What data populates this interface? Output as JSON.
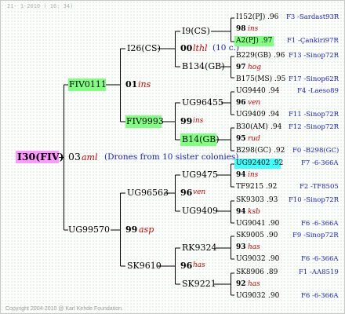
{
  "header": {
    "date_text": "21-  1-2010 ( 16: 34)"
  },
  "footer": {
    "copyright": "Copyright 2004-2010 @ Karl Kehde Foundation."
  },
  "colors": {
    "root_bg": "#ff99ff",
    "green_bg": "#80ff80",
    "cyan_bg": "#40ffff",
    "mating_text": "#cc0000",
    "link_text": "#1a1acc",
    "line": "#000000"
  },
  "root": {
    "name": "I30(FIV)",
    "year": "03",
    "mating": "aml",
    "note": "(Drones from 10 sister colonies)"
  },
  "gen1": {
    "top": "FIV0111",
    "bottom": "UG99570"
  },
  "gen2": [
    {
      "name": "I26(CS)",
      "year": "01",
      "mating": "ins"
    },
    {
      "name": "FIV9993"
    },
    {
      "name": "UG96563",
      "year": "99",
      "mating": "asp"
    },
    {
      "name": "SK9610"
    }
  ],
  "gen3": [
    {
      "name": "I9(CS)",
      "year": "00",
      "mating": "lthl",
      "note": "(10 c.)"
    },
    {
      "name": "B134(GB)"
    },
    {
      "name": "UG96455",
      "year": "99",
      "mating": "ins"
    },
    {
      "name": "B14(GB)"
    },
    {
      "name": "UG9475",
      "year": "96",
      "mating": "ven"
    },
    {
      "name": "UG9409"
    },
    {
      "name": "RK9324",
      "year": "96",
      "mating": "has"
    },
    {
      "name": "SK9221"
    }
  ],
  "gen4": [
    {
      "top": {
        "name": "I152(PJ)",
        "year": ".96",
        "info": "F3 -Sardast93R"
      },
      "mid": {
        "year": "98",
        "mating": "ins"
      },
      "bot": {
        "name": "A2(PJ)",
        "year": ".97",
        "info": "F1 -Çankiri97R"
      }
    },
    {
      "top": {
        "name": "B229(GB)",
        "year": ".96",
        "info": "F13 -Sinop72R"
      },
      "mid": {
        "year": "97",
        "mating": "hog"
      },
      "bot": {
        "name": "B175(MS)",
        "year": ".95",
        "info": "F17 -Sinop62R"
      }
    },
    {
      "top": {
        "name": "UG9440",
        "year": ".94",
        "info": "F4 -Laeso89"
      },
      "mid": {
        "year": "96",
        "mating": "ven"
      },
      "bot": {
        "name": "UG9409",
        "year": ".94",
        "info": "F11 -Sinop72R"
      }
    },
    {
      "top": {
        "name": "B30(AM)",
        "year": ".94",
        "info": "F12 -Sinop72R"
      },
      "mid": {
        "year": "95",
        "mating": "rud"
      },
      "bot": {
        "name": "B298(GC)",
        "year": ".92",
        "info": "F0 -B298(GC)"
      }
    },
    {
      "top": {
        "name": "UG92402",
        "year": ".92",
        "info": "F7 -6-366A"
      },
      "mid": {
        "year": "94",
        "mating": "ins"
      },
      "bot": {
        "name": "TF9215",
        "year": ".92",
        "info": "F2 -TF8505"
      }
    },
    {
      "top": {
        "name": "SK9303",
        "year": ".93",
        "info": "F10 -Sinop72R"
      },
      "mid": {
        "year": "94",
        "mating": "ksb"
      },
      "bot": {
        "name": "UG9041",
        "year": ".90",
        "info": "F6 -6-366A"
      }
    },
    {
      "top": {
        "name": "SK9005",
        "year": ".90",
        "info": "F9 -Sinop72R"
      },
      "mid": {
        "year": "93",
        "mating": "has"
      },
      "bot": {
        "name": "UG9032",
        "year": ".90",
        "info": "F6 -6-366A"
      }
    },
    {
      "top": {
        "name": "SK8906",
        "year": ".89",
        "info": "F1 -AA8519"
      },
      "mid": {
        "year": "92",
        "mating": "has"
      },
      "bot": {
        "name": "UG9032",
        "year": ".90",
        "info": "F6 -6-366A"
      }
    }
  ]
}
